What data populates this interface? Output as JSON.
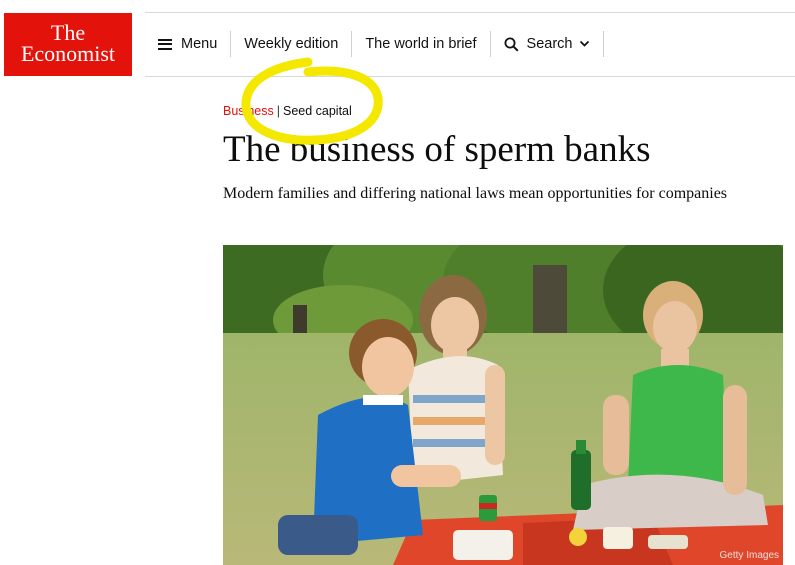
{
  "logo": {
    "line1": "The",
    "line2": "Economist"
  },
  "nav": {
    "menu_label": "Menu",
    "weekly_edition": "Weekly edition",
    "world_in_brief": "The world in brief",
    "search_label": "Search"
  },
  "article": {
    "section": "Business",
    "separator": "|",
    "flytitle": "Seed capital",
    "headline": "The business of sperm banks",
    "subheadline": "Modern families and differing national laws mean opportunities for companies",
    "image_credit": "Getty Images"
  },
  "colors": {
    "brand_red": "#e3120b",
    "annotation_yellow": "#f5e800"
  },
  "icons": [
    "hamburger-icon",
    "search-icon",
    "chevron-down-icon"
  ]
}
